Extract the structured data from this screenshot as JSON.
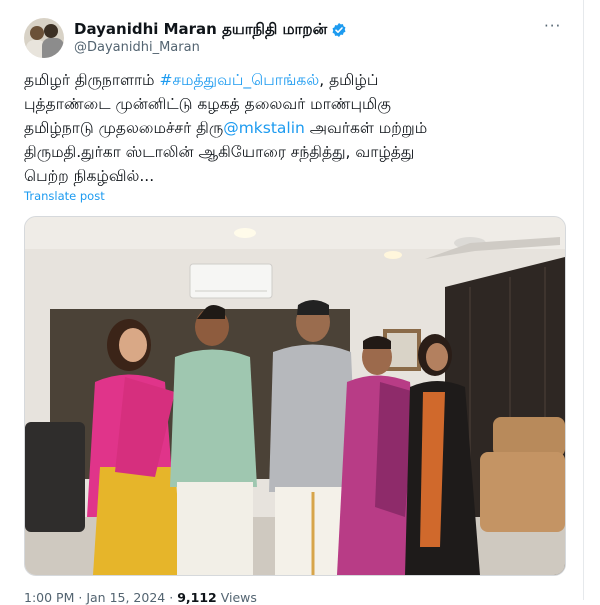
{
  "author": {
    "display_name": "Dayanidhi Maran தயாநிதி மாறன்",
    "handle": "@Dayanidhi_Maran",
    "verified_icon": "verified-badge-icon",
    "verified_color": "#1d9bf0"
  },
  "post": {
    "line1_pre": "தமிழர் திருநாளாம் ",
    "line1_hashtag": "#சமத்துவப்_பொங்கல்",
    "line1_post": ", தமிழ்ப்",
    "line2": "புத்தாண்டை முன்னிட்டு கழகத் தலைவர் மாண்புமிகு",
    "line3_pre": "தமிழ்நாடு முதலமைச்சர் திரு",
    "line3_mention": "@mkstalin",
    "line3_post": " அவர்கள் மற்றும்",
    "line4": "திருமதி.துர்கா ஸ்டாலின் ஆகியோரை சந்தித்து, வாழ்த்து",
    "line5": "பெற்ற நிகழ்வில்...",
    "translate_label": "Translate post",
    "link_color": "#1d9bf0"
  },
  "more_menu": {
    "icon": "more-horizontal-icon",
    "label": "···"
  },
  "meta": {
    "time": "1:00 PM",
    "separator": "·",
    "date": "Jan 15, 2024",
    "views_count": "9,112",
    "views_label": "Views"
  }
}
